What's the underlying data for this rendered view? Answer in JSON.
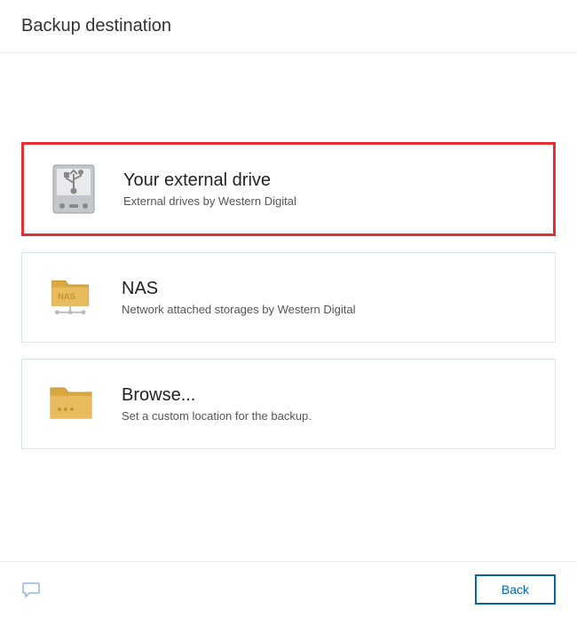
{
  "header": {
    "title": "Backup destination"
  },
  "options": {
    "external_drive": {
      "title": "Your external drive",
      "subtitle": "External drives by Western Digital"
    },
    "nas": {
      "title": "NAS",
      "subtitle": "Network attached storages by Western Digital"
    },
    "browse": {
      "title": "Browse...",
      "subtitle": "Set a custom location for the backup."
    }
  },
  "footer": {
    "back_label": "Back"
  }
}
